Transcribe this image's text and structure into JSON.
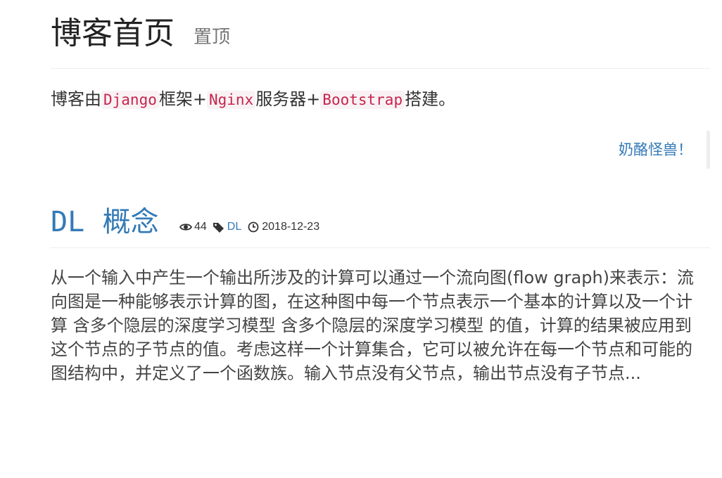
{
  "header": {
    "title": "博客首页",
    "subtitle": "置顶"
  },
  "intro": {
    "prefix": "博客由",
    "tech1": "Django",
    "joiner1": "框架+",
    "tech2": "Nginx",
    "joiner2": "服务器+",
    "tech3": "Bootstrap",
    "suffix": "搭建。"
  },
  "quote": {
    "text": "奶酪怪兽！"
  },
  "article": {
    "title_en": "DL",
    "title_zh": "概念",
    "views": "44",
    "tag": "DL",
    "date": "2018-12-23",
    "excerpt": "从一个输入中产生一个输出所涉及的计算可以通过一个流向图(flow graph)来表示：流向图是一种能够表示计算的图，在这种图中每一个节点表示一个基本的计算以及一个计算 含多个隐层的深度学习模型 含多个隐层的深度学习模型 的值，计算的结果被应用到这个节点的子节点的值。考虑这样一个计算集合，它可以被允许在每一个节点和可能的图结构中，并定义了一个函数族。输入节点没有父节点，输出节点没有子节点..."
  },
  "icons": {
    "views": "eye-icon",
    "tag": "tag-icon",
    "date": "clock-icon"
  },
  "colors": {
    "link": "#337ab7",
    "code_text": "#c7254e",
    "code_bg": "#f9f2f4",
    "divider": "#eeeeee"
  }
}
